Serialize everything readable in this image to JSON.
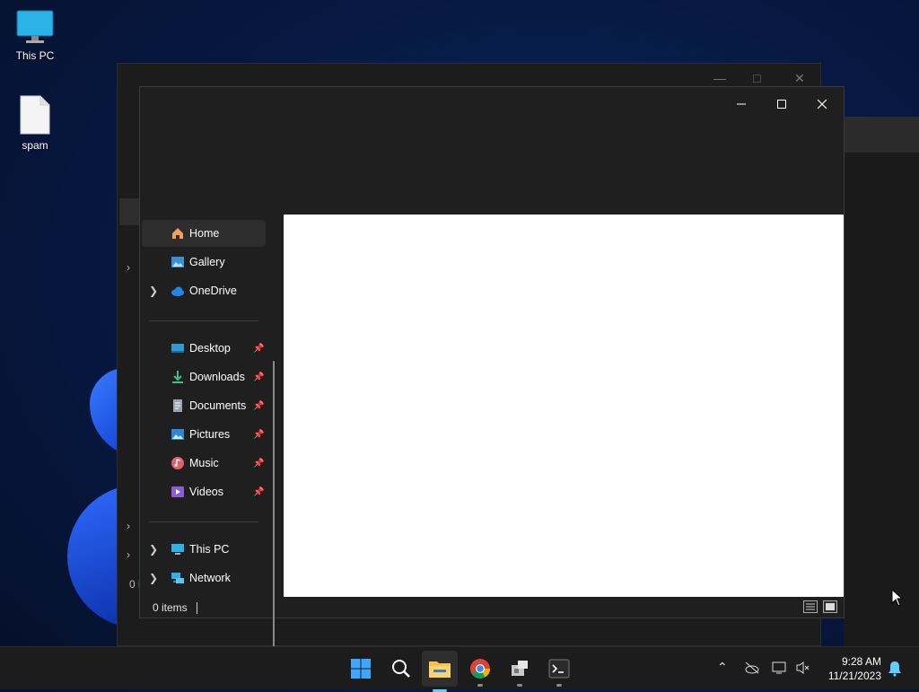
{
  "desktop": {
    "icons": [
      {
        "label": "This PC",
        "icon": "monitor-icon"
      },
      {
        "label": "spam",
        "icon": "file-icon"
      }
    ]
  },
  "back_window": {
    "status_fragment": "0 i"
  },
  "explorer": {
    "nav": {
      "pinned_top": [
        {
          "label": "Home",
          "icon": "home-icon",
          "selected": true
        },
        {
          "label": "Gallery",
          "icon": "gallery-icon"
        },
        {
          "label": "OneDrive",
          "icon": "onedrive-icon",
          "expandable": true
        }
      ],
      "quick_access": [
        {
          "label": "Desktop",
          "icon": "desktop-folder-icon"
        },
        {
          "label": "Downloads",
          "icon": "downloads-icon"
        },
        {
          "label": "Documents",
          "icon": "documents-icon"
        },
        {
          "label": "Pictures",
          "icon": "pictures-icon"
        },
        {
          "label": "Music",
          "icon": "music-icon"
        },
        {
          "label": "Videos",
          "icon": "videos-icon"
        }
      ],
      "locations": [
        {
          "label": "This PC",
          "icon": "this-pc-icon"
        },
        {
          "label": "Network",
          "icon": "network-icon"
        }
      ]
    },
    "status": {
      "items": "0 items"
    }
  },
  "taskbar": {
    "apps": [
      "start-icon",
      "search-icon",
      "file-explorer-icon",
      "chrome-icon",
      "app-installer-icon",
      "terminal-icon"
    ],
    "clock": {
      "time": "9:28 AM",
      "date": "11/21/2023"
    }
  },
  "colors": {
    "accent": "#60cdff",
    "window_bg": "#1f1f1f",
    "content_bg": "#ffffff",
    "taskbar_bg": "#1c1c1c"
  }
}
